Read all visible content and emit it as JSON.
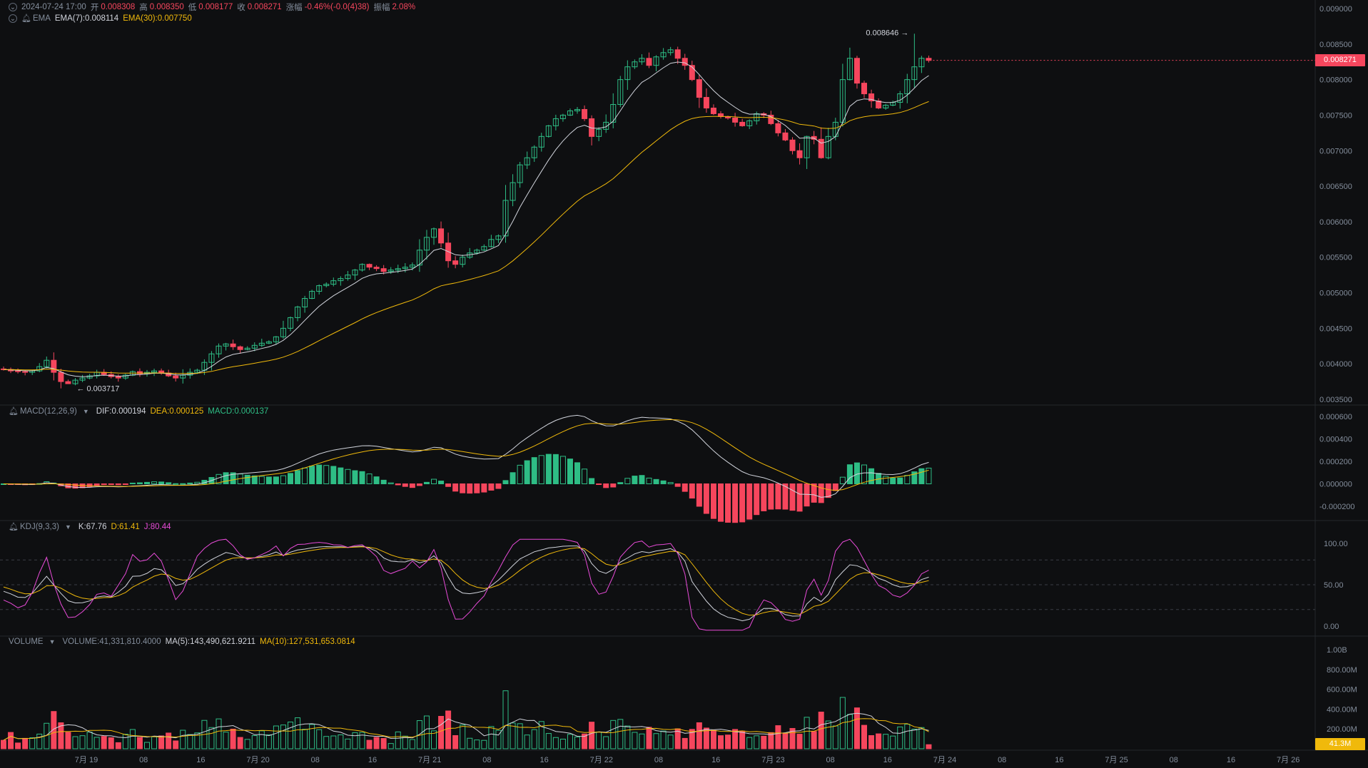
{
  "ohlc_bar": {
    "datetime": "2024-07-24 17:00",
    "open_label": "开",
    "open": "0.008308",
    "high_label": "高",
    "high": "0.008350",
    "low_label": "低",
    "low": "0.008177",
    "close_label": "收",
    "close": "0.008271",
    "change_label": "涨幅",
    "change": "-0.46%(-0.0(4)38)",
    "amplitude_label": "振幅",
    "amplitude": "2.08%"
  },
  "ema_legend": {
    "name": "EMA",
    "ema7": "EMA(7):0.008114",
    "ema30": "EMA(30):0.007750"
  },
  "macd_legend": {
    "name": "MACD(12,26,9)",
    "dif": "DIF:0.000194",
    "dea": "DEA:0.000125",
    "macd": "MACD:0.000137"
  },
  "kdj_legend": {
    "name": "KDJ(9,3,3)",
    "k": "K:67.76",
    "d": "D:61.41",
    "j": "J:80.44"
  },
  "volume_legend": {
    "name": "VOLUME",
    "volume": "VOLUME:41,331,810.4000",
    "ma5": "MA(5):143,490,621.9211",
    "ma10": "MA(10):127,531,653.0814"
  },
  "price_axis": [
    "0.009000",
    "0.008500",
    "0.008000",
    "0.007500",
    "0.007000",
    "0.006500",
    "0.006000",
    "0.005500",
    "0.005000",
    "0.004500",
    "0.004000",
    "0.003500"
  ],
  "macd_axis": [
    "0.000600",
    "0.000400",
    "0.000200",
    "0.000000",
    "-0.000200"
  ],
  "kdj_axis": [
    "100.00",
    "50.00",
    "0.00"
  ],
  "volume_axis": [
    "1.00B",
    "800.00M",
    "600.00M",
    "400.00M",
    "200.00M"
  ],
  "current_price_tag": "0.008271",
  "current_volume_tag": "41.3M",
  "high_marker": "0.008646 →",
  "low_marker": "← 0.003717",
  "time_axis": [
    "7月 19",
    "08",
    "16",
    "7月 20",
    "08",
    "16",
    "7月 21",
    "08",
    "16",
    "7月 22",
    "08",
    "16",
    "7月 23",
    "08",
    "16",
    "7月 24",
    "08",
    "16",
    "7月 25",
    "08",
    "16",
    "7月 26"
  ],
  "colors": {
    "up": "#2ebd85",
    "down": "#f6465d",
    "ema7": "#d1d4dc",
    "ema30": "#f0b90b",
    "j": "#e84bd8",
    "tag": "#f6465d",
    "vol_tag": "#f0b90b"
  },
  "chart_data": {
    "type": "candlestick",
    "interval": "1h",
    "close_series": [
      0.00392,
      0.0039,
      0.00389,
      0.00388,
      0.0039,
      0.00396,
      0.00405,
      0.00388,
      0.00375,
      0.00372,
      0.00377,
      0.0038,
      0.00383,
      0.00388,
      0.00385,
      0.00382,
      0.0038,
      0.00384,
      0.00389,
      0.00386,
      0.00388,
      0.0039,
      0.00387,
      0.00383,
      0.0038,
      0.00384,
      0.00388,
      0.00391,
      0.00402,
      0.00414,
      0.00425,
      0.00428,
      0.00424,
      0.0042,
      0.00422,
      0.00426,
      0.00429,
      0.00431,
      0.00438,
      0.0045,
      0.00465,
      0.0048,
      0.00492,
      0.00502,
      0.0051,
      0.00512,
      0.00517,
      0.0052,
      0.00525,
      0.00532,
      0.0054,
      0.00536,
      0.00534,
      0.0053,
      0.00532,
      0.00534,
      0.00536,
      0.00539,
      0.0056,
      0.00578,
      0.0059,
      0.0057,
      0.00545,
      0.0054,
      0.0055,
      0.00556,
      0.0056,
      0.00565,
      0.00575,
      0.0058,
      0.0063,
      0.00655,
      0.0068,
      0.0069,
      0.00705,
      0.0072,
      0.00735,
      0.00745,
      0.0075,
      0.00756,
      0.00758,
      0.00745,
      0.0072,
      0.0073,
      0.0074,
      0.00765,
      0.008,
      0.00818,
      0.00825,
      0.0083,
      0.0082,
      0.00832,
      0.00838,
      0.00842,
      0.0083,
      0.0082,
      0.008,
      0.00775,
      0.0076,
      0.00752,
      0.00748,
      0.00746,
      0.0074,
      0.00735,
      0.00742,
      0.00752,
      0.0075,
      0.00738,
      0.00725,
      0.00715,
      0.007,
      0.0069,
      0.0072,
      0.00716,
      0.0069,
      0.0072,
      0.0074,
      0.008,
      0.0083,
      0.00795,
      0.0078,
      0.0077,
      0.0076,
      0.00764,
      0.00768,
      0.0078,
      0.008,
      0.00818,
      0.0083,
      0.00827
    ],
    "ema7": "0.008114",
    "ema30": "0.007750",
    "high": 0.008646,
    "low": 0.003717,
    "ylim": [
      0.0035,
      0.009
    ],
    "macd": {
      "dif": 0.000194,
      "dea": 0.000125,
      "macd": 0.000137,
      "ylim": [
        -0.0003,
        0.0007
      ]
    },
    "kdj": {
      "k": 67.76,
      "d": 61.41,
      "j": 80.44,
      "ylim": [
        -10,
        110
      ]
    },
    "volume": {
      "last": 41331810.4,
      "ma5": 143490621.9211,
      "ma10": 127531653.0814,
      "ylim": [
        0,
        1050000000
      ]
    }
  }
}
